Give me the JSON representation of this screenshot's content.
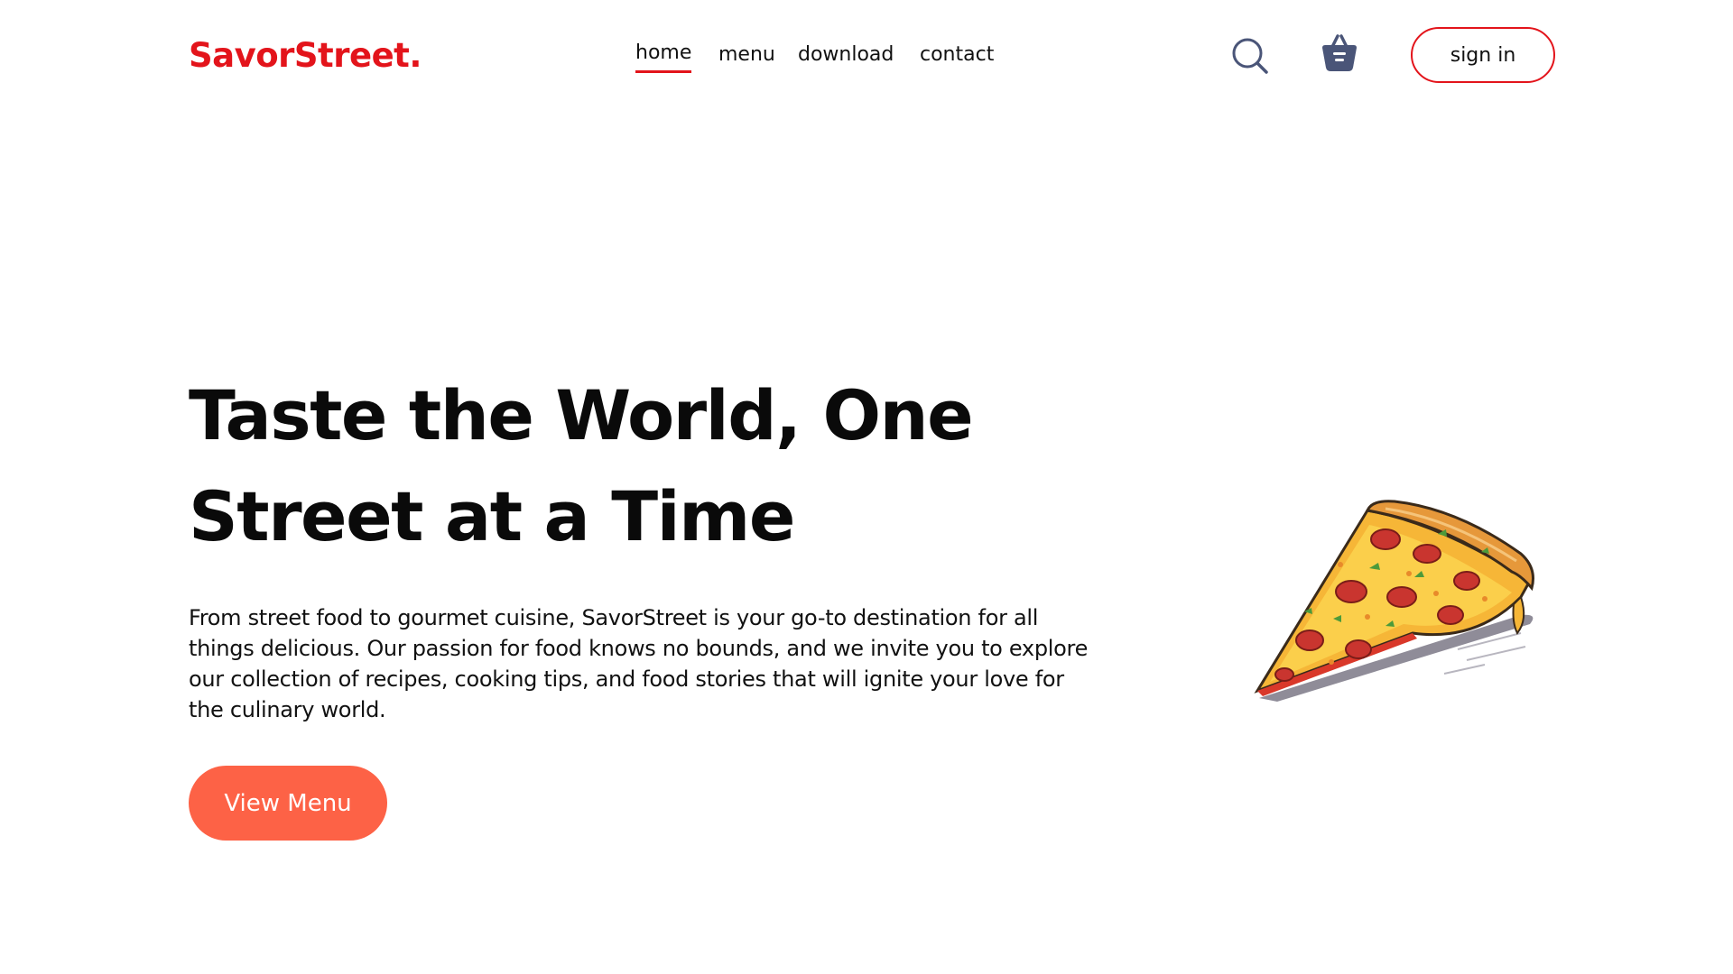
{
  "brand": {
    "logo_text": "SavorStreet."
  },
  "nav": {
    "items": [
      {
        "label": "home",
        "active": true
      },
      {
        "label": "menu",
        "active": false
      },
      {
        "label": "download",
        "active": false
      },
      {
        "label": "contact",
        "active": false
      }
    ]
  },
  "header": {
    "search_icon": "search-icon",
    "cart_icon": "basket-icon",
    "signin_label": "sign in"
  },
  "hero": {
    "title_line1": "Taste the World, One",
    "title_line2": "Street at a Time",
    "description": "From street food to gourmet cuisine, SavorStreet is your go-to destination for all things delicious. Our passion for food knows no bounds, and we invite you to explore our collection of recipes, cooking tips, and food stories that will ignite your love for the culinary world.",
    "cta_label": "View Menu",
    "image": "pizza-slice-illustration"
  },
  "colors": {
    "brand_red": "#e3141b",
    "cta_orange": "#fd6246",
    "icon_slate": "#4a5578",
    "text": "#111111"
  }
}
